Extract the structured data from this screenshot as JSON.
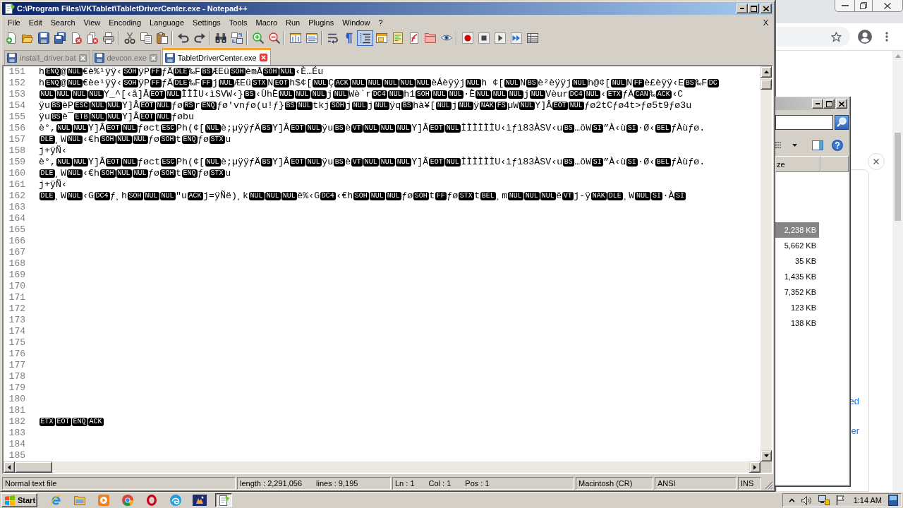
{
  "editor_window": {
    "title": "C:\\Program Files\\VKTablet\\TabletDriverCenter.exe - Notepad++",
    "menu": [
      "File",
      "Edit",
      "Search",
      "View",
      "Encoding",
      "Language",
      "Settings",
      "Tools",
      "Macro",
      "Run",
      "Plugins",
      "Window",
      "?"
    ],
    "close_document": "X",
    "toolbar": [
      [
        {
          "on": false
        },
        {
          "on": false
        },
        {
          "on": false
        },
        {
          "on": false
        },
        {
          "on": false
        },
        {
          "on": false
        },
        {
          "on": false
        }
      ],
      [
        {
          "on": false
        },
        {
          "on": false
        },
        {
          "on": false
        }
      ],
      [
        {
          "on": false
        },
        {
          "on": false
        }
      ],
      [
        {
          "on": false
        },
        {
          "on": false
        }
      ],
      [
        {
          "on": false
        },
        {
          "on": false
        }
      ],
      [
        {
          "on": false
        },
        {
          "on": false
        }
      ],
      [
        {
          "on": false
        },
        {
          "on": false
        },
        {
          "on": true
        },
        {
          "on": false
        },
        {
          "on": false
        },
        {
          "on": false
        },
        {
          "on": false
        },
        {
          "on": false
        }
      ],
      [
        {
          "on": false
        },
        {
          "on": false
        },
        {
          "on": false
        },
        {
          "on": false
        },
        {
          "on": false
        }
      ]
    ],
    "tabs": [
      {
        "label": "install_driver.bat",
        "selected": false
      },
      {
        "label": "devcon.exe",
        "selected": false
      },
      {
        "label": "TabletDriverCenter.exe",
        "selected": true
      }
    ],
    "lines": [
      {
        "number": "151",
        "segments": [
          {
            "kind": "text",
            "text": "h"
          },
          {
            "kind": "control",
            "text": "ENQ"
          },
          {
            "kind": "text",
            "text": "@"
          },
          {
            "kind": "control",
            "text": "NUL"
          },
          {
            "kind": "text",
            "text": "€è%¹ÿÿ‹"
          },
          {
            "kind": "control",
            "text": "SOH"
          },
          {
            "kind": "text",
            "text": "ÿP"
          },
          {
            "kind": "control",
            "text": "FF"
          },
          {
            "kind": "text",
            "text": "ƒÄ"
          },
          {
            "kind": "control",
            "text": "DLE"
          },
          {
            "kind": "text",
            "text": "‰F"
          },
          {
            "kind": "control",
            "text": "BS"
          },
          {
            "kind": "text",
            "text": "ÆEü"
          },
          {
            "kind": "control",
            "text": "SOH"
          },
          {
            "kind": "text",
            "text": "èmÅ"
          },
          {
            "kind": "control",
            "text": "SOH"
          },
          {
            "kind": "control",
            "text": "NUL"
          },
          {
            "kind": "text",
            "text": "‹È…Éu"
          }
        ]
      },
      {
        "number": "152",
        "segments": [
          {
            "kind": "text",
            "text": "h"
          },
          {
            "kind": "control",
            "text": "ENQ"
          },
          {
            "kind": "text",
            "text": "@"
          },
          {
            "kind": "control",
            "text": "NUL"
          },
          {
            "kind": "text",
            "text": "€èe¹ÿÿ‹"
          },
          {
            "kind": "control",
            "text": "SOH"
          },
          {
            "kind": "text",
            "text": "ÿP"
          },
          {
            "kind": "control",
            "text": "FF"
          },
          {
            "kind": "text",
            "text": "ƒÄ"
          },
          {
            "kind": "control",
            "text": "DLE"
          },
          {
            "kind": "text",
            "text": "‰F"
          },
          {
            "kind": "control",
            "text": "FF"
          },
          {
            "kind": "text",
            "text": "j"
          },
          {
            "kind": "control",
            "text": "NUL"
          },
          {
            "kind": "text",
            "text": "ÆEü"
          },
          {
            "kind": "control",
            "text": "STX"
          },
          {
            "kind": "text",
            "text": "N"
          },
          {
            "kind": "control",
            "text": "EOT"
          },
          {
            "kind": "text",
            "text": "h$¢["
          },
          {
            "kind": "control",
            "text": "NUL"
          },
          {
            "kind": "text",
            "text": "Ç"
          },
          {
            "kind": "control",
            "text": "ACK"
          },
          {
            "kind": "control",
            "text": "NUL"
          },
          {
            "kind": "control",
            "text": "NUL"
          },
          {
            "kind": "control",
            "text": "NUL"
          },
          {
            "kind": "control",
            "text": "NUL"
          },
          {
            "kind": "control",
            "text": "NUL"
          },
          {
            "kind": "text",
            "text": "èÁèÿÿj"
          },
          {
            "kind": "control",
            "text": "NUL"
          },
          {
            "kind": "text",
            "text": "h ¢["
          },
          {
            "kind": "control",
            "text": "NUL"
          },
          {
            "kind": "text",
            "text": "N"
          },
          {
            "kind": "control",
            "text": "BS"
          },
          {
            "kind": "text",
            "text": "è²èÿÿj"
          },
          {
            "kind": "control",
            "text": "NUL"
          },
          {
            "kind": "text",
            "text": "h@¢["
          },
          {
            "kind": "control",
            "text": "NUL"
          },
          {
            "kind": "text",
            "text": "N"
          },
          {
            "kind": "control",
            "text": "FF"
          },
          {
            "kind": "text",
            "text": "è£èÿÿ‹E"
          },
          {
            "kind": "control",
            "text": "BS"
          },
          {
            "kind": "text",
            "text": "‰F"
          },
          {
            "kind": "control",
            "text": "DC"
          }
        ]
      },
      {
        "number": "153",
        "segments": [
          {
            "kind": "control",
            "text": "NUL"
          },
          {
            "kind": "control",
            "text": "NUL"
          },
          {
            "kind": "control",
            "text": "NUL"
          },
          {
            "kind": "control",
            "text": "NUL"
          },
          {
            "kind": "text",
            "text": "Y_^[‹å]Â"
          },
          {
            "kind": "control",
            "text": "EOT"
          },
          {
            "kind": "control",
            "text": "NUL"
          },
          {
            "kind": "text",
            "text": "ÌÌÌU‹ìSVW‹}"
          },
          {
            "kind": "control",
            "text": "BS"
          },
          {
            "kind": "text",
            "text": "‹ÙhÈ"
          },
          {
            "kind": "control",
            "text": "NUL"
          },
          {
            "kind": "control",
            "text": "NUL"
          },
          {
            "kind": "control",
            "text": "NUL"
          },
          {
            "kind": "text",
            "text": "j"
          },
          {
            "kind": "control",
            "text": "NUL"
          },
          {
            "kind": "text",
            "text": "Wè`r"
          },
          {
            "kind": "control",
            "text": "DC4"
          },
          {
            "kind": "control",
            "text": "NUL"
          },
          {
            "kind": "text",
            "text": "h1"
          },
          {
            "kind": "control",
            "text": "SOH"
          },
          {
            "kind": "control",
            "text": "NUL"
          },
          {
            "kind": "control",
            "text": "NUL"
          },
          {
            "kind": "text",
            "text": "·È"
          },
          {
            "kind": "control",
            "text": "NUL"
          },
          {
            "kind": "control",
            "text": "NUL"
          },
          {
            "kind": "control",
            "text": "NUL"
          },
          {
            "kind": "text",
            "text": "j"
          },
          {
            "kind": "control",
            "text": "NUL"
          },
          {
            "kind": "text",
            "text": "Vèur"
          },
          {
            "kind": "control",
            "text": "DC4"
          },
          {
            "kind": "control",
            "text": "NUL"
          },
          {
            "kind": "text",
            "text": "‹"
          },
          {
            "kind": "control",
            "text": "ETX"
          },
          {
            "kind": "text",
            "text": "ƒÄ"
          },
          {
            "kind": "control",
            "text": "CAN"
          },
          {
            "kind": "text",
            "text": "‰"
          },
          {
            "kind": "control",
            "text": "ACK"
          },
          {
            "kind": "text",
            "text": "‹C"
          }
        ]
      },
      {
        "number": "154",
        "segments": [
          {
            "kind": "text",
            "text": "ÿu"
          },
          {
            "kind": "control",
            "text": "BS"
          },
          {
            "kind": "text",
            "text": "èP"
          },
          {
            "kind": "control",
            "text": "ESC"
          },
          {
            "kind": "control",
            "text": "NUL"
          },
          {
            "kind": "control",
            "text": "NUL"
          },
          {
            "kind": "text",
            "text": "Y]Â"
          },
          {
            "kind": "control",
            "text": "EOT"
          },
          {
            "kind": "control",
            "text": "NUL"
          },
          {
            "kind": "text",
            "text": "ƒø"
          },
          {
            "kind": "control",
            "text": "RS"
          },
          {
            "kind": "text",
            "text": "r"
          },
          {
            "kind": "control",
            "text": "ENQ"
          },
          {
            "kind": "text",
            "text": "ƒø'vnƒø(u!ƒ}"
          },
          {
            "kind": "control",
            "text": "BS"
          },
          {
            "kind": "control",
            "text": "NUL"
          },
          {
            "kind": "text",
            "text": "tkj"
          },
          {
            "kind": "control",
            "text": "SOH"
          },
          {
            "kind": "text",
            "text": "j"
          },
          {
            "kind": "control",
            "text": "NUL"
          },
          {
            "kind": "text",
            "text": "j"
          },
          {
            "kind": "control",
            "text": "NUL"
          },
          {
            "kind": "text",
            "text": "ÿq"
          },
          {
            "kind": "control",
            "text": "BS"
          },
          {
            "kind": "text",
            "text": "hà¥["
          },
          {
            "kind": "control",
            "text": "NUL"
          },
          {
            "kind": "text",
            "text": "j"
          },
          {
            "kind": "control",
            "text": "NUL"
          },
          {
            "kind": "text",
            "text": "ÿ"
          },
          {
            "kind": "control",
            "text": "NAK"
          },
          {
            "kind": "control",
            "text": "FS"
          },
          {
            "kind": "text",
            "text": "µW"
          },
          {
            "kind": "control",
            "text": "NUL"
          },
          {
            "kind": "text",
            "text": "Y]Â"
          },
          {
            "kind": "control",
            "text": "EOT"
          },
          {
            "kind": "control",
            "text": "NUL"
          },
          {
            "kind": "text",
            "text": "ƒø2tCƒø4t>ƒø5t9ƒø3u"
          }
        ]
      },
      {
        "number": "155",
        "segments": [
          {
            "kind": "text",
            "text": "ÿu"
          },
          {
            "kind": "control",
            "text": "BS"
          },
          {
            "kind": "text",
            "text": "è¯"
          },
          {
            "kind": "control",
            "text": "ETB"
          },
          {
            "kind": "control",
            "text": "NUL"
          },
          {
            "kind": "control",
            "text": "NUL"
          },
          {
            "kind": "text",
            "text": "Y]Â"
          },
          {
            "kind": "control",
            "text": "EOT"
          },
          {
            "kind": "control",
            "text": "NUL"
          },
          {
            "kind": "text",
            "text": "ƒøbu"
          }
        ]
      },
      {
        "number": "156",
        "segments": [
          {
            "kind": "text",
            "text": "è°,"
          },
          {
            "kind": "control",
            "text": "NUL"
          },
          {
            "kind": "control",
            "text": "NUL"
          },
          {
            "kind": "text",
            "text": "Y]Â"
          },
          {
            "kind": "control",
            "text": "EOT"
          },
          {
            "kind": "control",
            "text": "NUL"
          },
          {
            "kind": "text",
            "text": "ƒøct"
          },
          {
            "kind": "control",
            "text": "ESC"
          },
          {
            "kind": "text",
            "text": "Ph(¢["
          },
          {
            "kind": "control",
            "text": "NUL"
          },
          {
            "kind": "text",
            "text": "è;µÿÿƒÄ"
          },
          {
            "kind": "control",
            "text": "BS"
          },
          {
            "kind": "text",
            "text": "Y]Â"
          },
          {
            "kind": "control",
            "text": "EOT"
          },
          {
            "kind": "control",
            "text": "NUL"
          },
          {
            "kind": "text",
            "text": "ÿu"
          },
          {
            "kind": "control",
            "text": "BS"
          },
          {
            "kind": "text",
            "text": "è"
          },
          {
            "kind": "control",
            "text": "VT"
          },
          {
            "kind": "control",
            "text": "NUL"
          },
          {
            "kind": "control",
            "text": "NUL"
          },
          {
            "kind": "control",
            "text": "NUL"
          },
          {
            "kind": "text",
            "text": "Y]Â"
          },
          {
            "kind": "control",
            "text": "EOT"
          },
          {
            "kind": "control",
            "text": "NUL"
          },
          {
            "kind": "text",
            "text": "ÌÌÌÌÌÌU‹ìƒì83ÀSV‹u"
          },
          {
            "kind": "control",
            "text": "BS"
          },
          {
            "kind": "text",
            "text": "…öW"
          },
          {
            "kind": "control",
            "text": "SI"
          },
          {
            "kind": "text",
            "text": "”À‹ù"
          },
          {
            "kind": "control",
            "text": "SI"
          },
          {
            "kind": "text",
            "text": "·Ø‹"
          },
          {
            "kind": "control",
            "text": "BEL"
          },
          {
            "kind": "text",
            "text": "ƒÀùƒø."
          }
        ]
      },
      {
        "number": "157",
        "segments": [
          {
            "kind": "control",
            "text": "DLE"
          },
          {
            "kind": "text",
            "text": "¸W"
          },
          {
            "kind": "control",
            "text": "NUL"
          },
          {
            "kind": "text",
            "text": "‹€h"
          },
          {
            "kind": "control",
            "text": "SOH"
          },
          {
            "kind": "control",
            "text": "NUL"
          },
          {
            "kind": "control",
            "text": "NUL"
          },
          {
            "kind": "text",
            "text": "ƒø"
          },
          {
            "kind": "control",
            "text": "SOH"
          },
          {
            "kind": "text",
            "text": "t"
          },
          {
            "kind": "control",
            "text": "ENQ"
          },
          {
            "kind": "text",
            "text": "ƒø"
          },
          {
            "kind": "control",
            "text": "STX"
          },
          {
            "kind": "text",
            "text": "u"
          }
        ]
      },
      {
        "number": "158",
        "segments": [
          {
            "kind": "text",
            "text": "j+ÿÑ‹"
          }
        ]
      },
      {
        "number": "159",
        "segments": [
          {
            "kind": "text",
            "text": "è°,"
          },
          {
            "kind": "control",
            "text": "NUL"
          },
          {
            "kind": "control",
            "text": "NUL"
          },
          {
            "kind": "text",
            "text": "Y]Â"
          },
          {
            "kind": "control",
            "text": "EOT"
          },
          {
            "kind": "control",
            "text": "NUL"
          },
          {
            "kind": "text",
            "text": "ƒøct"
          },
          {
            "kind": "control",
            "text": "ESC"
          },
          {
            "kind": "text",
            "text": "Ph(¢["
          },
          {
            "kind": "control",
            "text": "NUL"
          },
          {
            "kind": "text",
            "text": "è;µÿÿƒÄ"
          },
          {
            "kind": "control",
            "text": "BS"
          },
          {
            "kind": "text",
            "text": "Y]Â"
          },
          {
            "kind": "control",
            "text": "EOT"
          },
          {
            "kind": "control",
            "text": "NUL"
          },
          {
            "kind": "text",
            "text": "ÿu"
          },
          {
            "kind": "control",
            "text": "BS"
          },
          {
            "kind": "text",
            "text": "è"
          },
          {
            "kind": "control",
            "text": "VT"
          },
          {
            "kind": "control",
            "text": "NUL"
          },
          {
            "kind": "control",
            "text": "NUL"
          },
          {
            "kind": "control",
            "text": "NUL"
          },
          {
            "kind": "text",
            "text": "Y]Â"
          },
          {
            "kind": "control",
            "text": "EOT"
          },
          {
            "kind": "control",
            "text": "NUL"
          },
          {
            "kind": "text",
            "text": "ÌÌÌÌÌÌU‹ìƒì83ÀSV‹u"
          },
          {
            "kind": "control",
            "text": "BS"
          },
          {
            "kind": "text",
            "text": "…öW"
          },
          {
            "kind": "control",
            "text": "SI"
          },
          {
            "kind": "text",
            "text": "”À‹ù"
          },
          {
            "kind": "control",
            "text": "SI"
          },
          {
            "kind": "text",
            "text": "·Ø‹"
          },
          {
            "kind": "control",
            "text": "BEL"
          },
          {
            "kind": "text",
            "text": "ƒÀùƒø."
          }
        ]
      },
      {
        "number": "160",
        "segments": [
          {
            "kind": "control",
            "text": "DLE"
          },
          {
            "kind": "text",
            "text": "¸W"
          },
          {
            "kind": "control",
            "text": "NUL"
          },
          {
            "kind": "text",
            "text": "‹€h"
          },
          {
            "kind": "control",
            "text": "SOH"
          },
          {
            "kind": "control",
            "text": "NUL"
          },
          {
            "kind": "control",
            "text": "NUL"
          },
          {
            "kind": "text",
            "text": "ƒø"
          },
          {
            "kind": "control",
            "text": "SOH"
          },
          {
            "kind": "text",
            "text": "t"
          },
          {
            "kind": "control",
            "text": "ENQ"
          },
          {
            "kind": "text",
            "text": "ƒø"
          },
          {
            "kind": "control",
            "text": "STX"
          },
          {
            "kind": "text",
            "text": "u"
          }
        ]
      },
      {
        "number": "161",
        "segments": [
          {
            "kind": "text",
            "text": "j+ÿÑ‹"
          }
        ]
      },
      {
        "number": "162",
        "segments": [
          {
            "kind": "control",
            "text": "DLE"
          },
          {
            "kind": "text",
            "text": "¸W"
          },
          {
            "kind": "control",
            "text": "NUL"
          },
          {
            "kind": "text",
            "text": "‹G"
          },
          {
            "kind": "control",
            "text": "DC4"
          },
          {
            "kind": "text",
            "text": "ƒ¸h"
          },
          {
            "kind": "control",
            "text": "SOH"
          },
          {
            "kind": "control",
            "text": "NUL"
          },
          {
            "kind": "control",
            "text": "NUL"
          },
          {
            "kind": "text",
            "text": "\"u"
          },
          {
            "kind": "control",
            "text": "ACK"
          },
          {
            "kind": "text",
            "text": "j=ÿÑë)¸k"
          },
          {
            "kind": "control",
            "text": "NUL"
          },
          {
            "kind": "control",
            "text": "NUL"
          },
          {
            "kind": "control",
            "text": "NUL"
          },
          {
            "kind": "text",
            "text": "ë%‹G"
          },
          {
            "kind": "control",
            "text": "DC4"
          },
          {
            "kind": "text",
            "text": "‹€h"
          },
          {
            "kind": "control",
            "text": "SOH"
          },
          {
            "kind": "control",
            "text": "NUL"
          },
          {
            "kind": "control",
            "text": "NUL"
          },
          {
            "kind": "text",
            "text": "ƒø"
          },
          {
            "kind": "control",
            "text": "SOH"
          },
          {
            "kind": "text",
            "text": "t"
          },
          {
            "kind": "control",
            "text": "FF"
          },
          {
            "kind": "text",
            "text": "ƒø"
          },
          {
            "kind": "control",
            "text": "STX"
          },
          {
            "kind": "text",
            "text": "t"
          },
          {
            "kind": "control",
            "text": "BEL"
          },
          {
            "kind": "text",
            "text": "¸m"
          },
          {
            "kind": "control",
            "text": "NUL"
          },
          {
            "kind": "control",
            "text": "NUL"
          },
          {
            "kind": "control",
            "text": "NUL"
          },
          {
            "kind": "text",
            "text": "ë"
          },
          {
            "kind": "control",
            "text": "VT"
          },
          {
            "kind": "text",
            "text": "j-ÿ"
          },
          {
            "kind": "control",
            "text": "NAK"
          },
          {
            "kind": "control",
            "text": "DLE"
          },
          {
            "kind": "text",
            "text": "¸W"
          },
          {
            "kind": "control",
            "text": "NUL"
          },
          {
            "kind": "control",
            "text": "SI"
          },
          {
            "kind": "text",
            "text": "·À"
          },
          {
            "kind": "control",
            "text": "SI"
          }
        ]
      },
      {
        "number": "163"
      },
      {
        "number": "164"
      },
      {
        "number": "165"
      },
      {
        "number": "166"
      },
      {
        "number": "167"
      },
      {
        "number": "168"
      },
      {
        "number": "169"
      },
      {
        "number": "170"
      },
      {
        "number": "171"
      },
      {
        "number": "172"
      },
      {
        "number": "173"
      },
      {
        "number": "174"
      },
      {
        "number": "175"
      },
      {
        "number": "176"
      },
      {
        "number": "177"
      },
      {
        "number": "178"
      },
      {
        "number": "179"
      },
      {
        "number": "180"
      },
      {
        "number": "181"
      },
      {
        "number": "182",
        "segments": [
          {
            "kind": "control",
            "text": "ETX"
          },
          {
            "kind": "control",
            "text": "EOT"
          },
          {
            "kind": "control",
            "text": "ENQ"
          },
          {
            "kind": "control",
            "text": "ACK"
          }
        ]
      },
      {
        "number": "183"
      },
      {
        "number": "184"
      },
      {
        "number": "185"
      }
    ],
    "status_bar": [
      [
        "Normal text file"
      ],
      [
        "length : 2,291,056",
        "lines : 9,195"
      ],
      [
        "Ln : 1",
        "Col : 1",
        "Pos : 1"
      ],
      [
        "Macintosh (CR)"
      ],
      [
        "ANSI"
      ],
      [
        "INS"
      ]
    ]
  },
  "explorer_window": {
    "column_header": "ze",
    "sizes": [
      {
        "text": "2,238 KB",
        "selected": true
      },
      {
        "text": "5,662 KB",
        "selected": false
      },
      {
        "text": "35 KB",
        "selected": false
      },
      {
        "text": "1,435 KB",
        "selected": false
      },
      {
        "text": "7,352 KB",
        "selected": false
      },
      {
        "text": "123 KB",
        "selected": false
      },
      {
        "text": "138 KB",
        "selected": false
      }
    ]
  },
  "browser_window": {
    "links": [
      "ed",
      "er"
    ]
  },
  "taskbar": {
    "start": "Start",
    "apps": [
      {
        "selected": false
      },
      {
        "selected": false
      },
      {
        "selected": false
      },
      {
        "selected": false
      },
      {
        "selected": false
      },
      {
        "selected": false
      },
      {
        "selected": false
      },
      {
        "selected": true
      }
    ],
    "clock": "1:14 AM"
  }
}
